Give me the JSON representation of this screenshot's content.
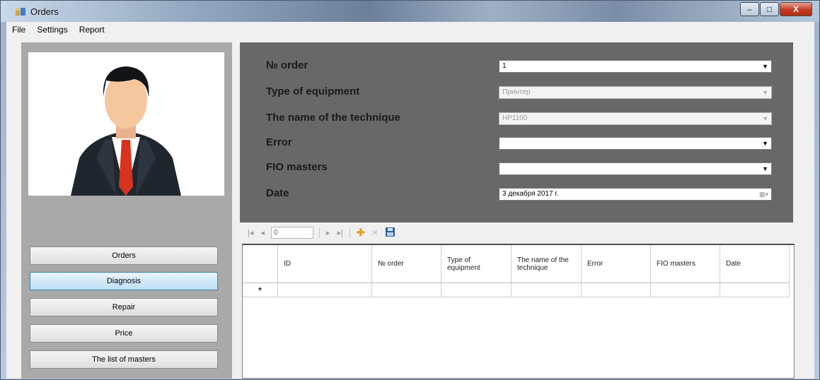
{
  "window": {
    "title": "Orders",
    "controls": {
      "minimize": "–",
      "maximize": "□",
      "close": "X"
    }
  },
  "menu": [
    "File",
    "Settings",
    "Report"
  ],
  "sidebar": {
    "buttons": [
      {
        "label": "Orders",
        "active": false
      },
      {
        "label": "Diagnosis",
        "active": true
      },
      {
        "label": "Repair",
        "active": false
      },
      {
        "label": "Price",
        "active": false
      },
      {
        "label": "The list of masters",
        "active": false
      }
    ]
  },
  "form": {
    "fields": [
      {
        "label": "№ order",
        "value": "1",
        "disabled": false
      },
      {
        "label": "Type of equipment",
        "value": "Принтер",
        "disabled": true
      },
      {
        "label": "The name of the technique",
        "value": "HP1100",
        "disabled": true
      },
      {
        "label": "Error",
        "value": "",
        "disabled": false
      },
      {
        "label": "FIO masters",
        "value": "",
        "disabled": false
      },
      {
        "label": "Date",
        "value": "3 декабря 2017 г.",
        "disabled": false
      }
    ]
  },
  "navigator": {
    "position": "0",
    "icons": [
      "move-first-icon",
      "move-previous-icon",
      "move-next-icon",
      "move-last-icon",
      "add-new-icon",
      "delete-icon",
      "save-icon"
    ]
  },
  "grid": {
    "columns": [
      "ID",
      "№ order",
      "Type of equipment",
      "The name of the technique",
      "Error",
      "FIO masters",
      "Date"
    ],
    "new_row_marker": "*"
  },
  "colors": {
    "form_bg": "#686868",
    "left_panel_bg": "#a9a9a9",
    "active_button": "#bfe0f6"
  }
}
